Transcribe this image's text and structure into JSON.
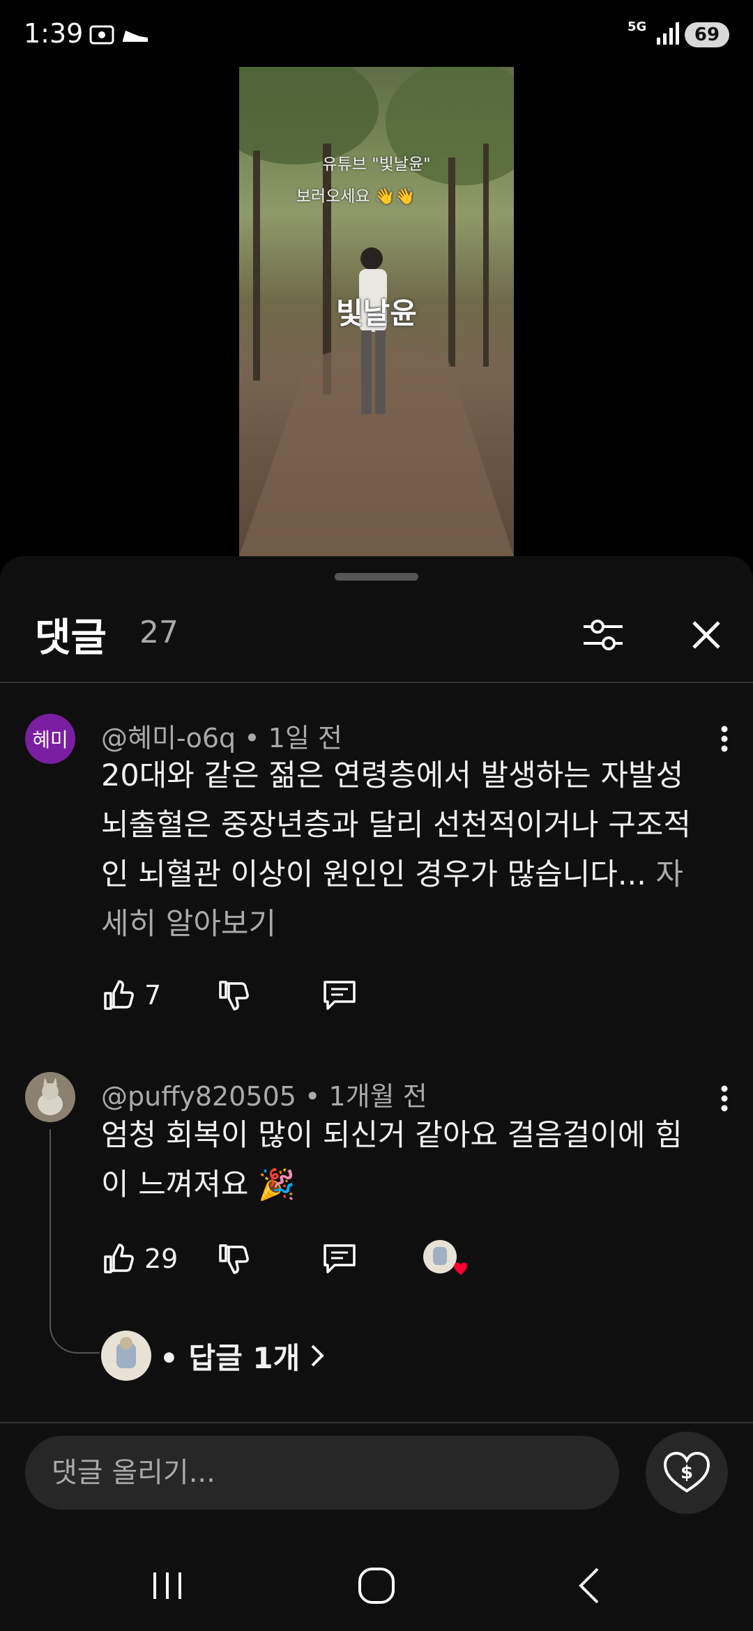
{
  "status_bar": {
    "time": "1:39",
    "network": "5G",
    "battery": "69"
  },
  "video": {
    "overlay_line1": "유튜브 \"빛날윤\"",
    "overlay_line2": "보러오세요 👋👋",
    "watermark": "빛날윤"
  },
  "comments_panel": {
    "title": "댓글",
    "count": "27",
    "input_placeholder": "댓글 올리기..."
  },
  "comments": [
    {
      "avatar_letter": "혜미",
      "avatar_color": "#7b1fa2",
      "author": "@혜미-o6q",
      "time": "1일 전",
      "text": "20대와 같은 젊은 연령층에서 발생하는 자발성 뇌출혈은 중장년층과 달리 선천적이거나 구조적인 뇌혈관 이상이 원인인 경우가 많습니다...",
      "more": " 자세히 알아보기",
      "likes": "7"
    },
    {
      "author": "@puffy820505",
      "time": "1개월 전",
      "text": "엄청 회복이 많이 되신거 같아요 걸음걸이에 힘이 느껴져요 🎉",
      "likes": "29",
      "replies": "• 답글 1개"
    }
  ],
  "navigation": {
    "recents": "recents",
    "home": "home",
    "back": "back"
  }
}
